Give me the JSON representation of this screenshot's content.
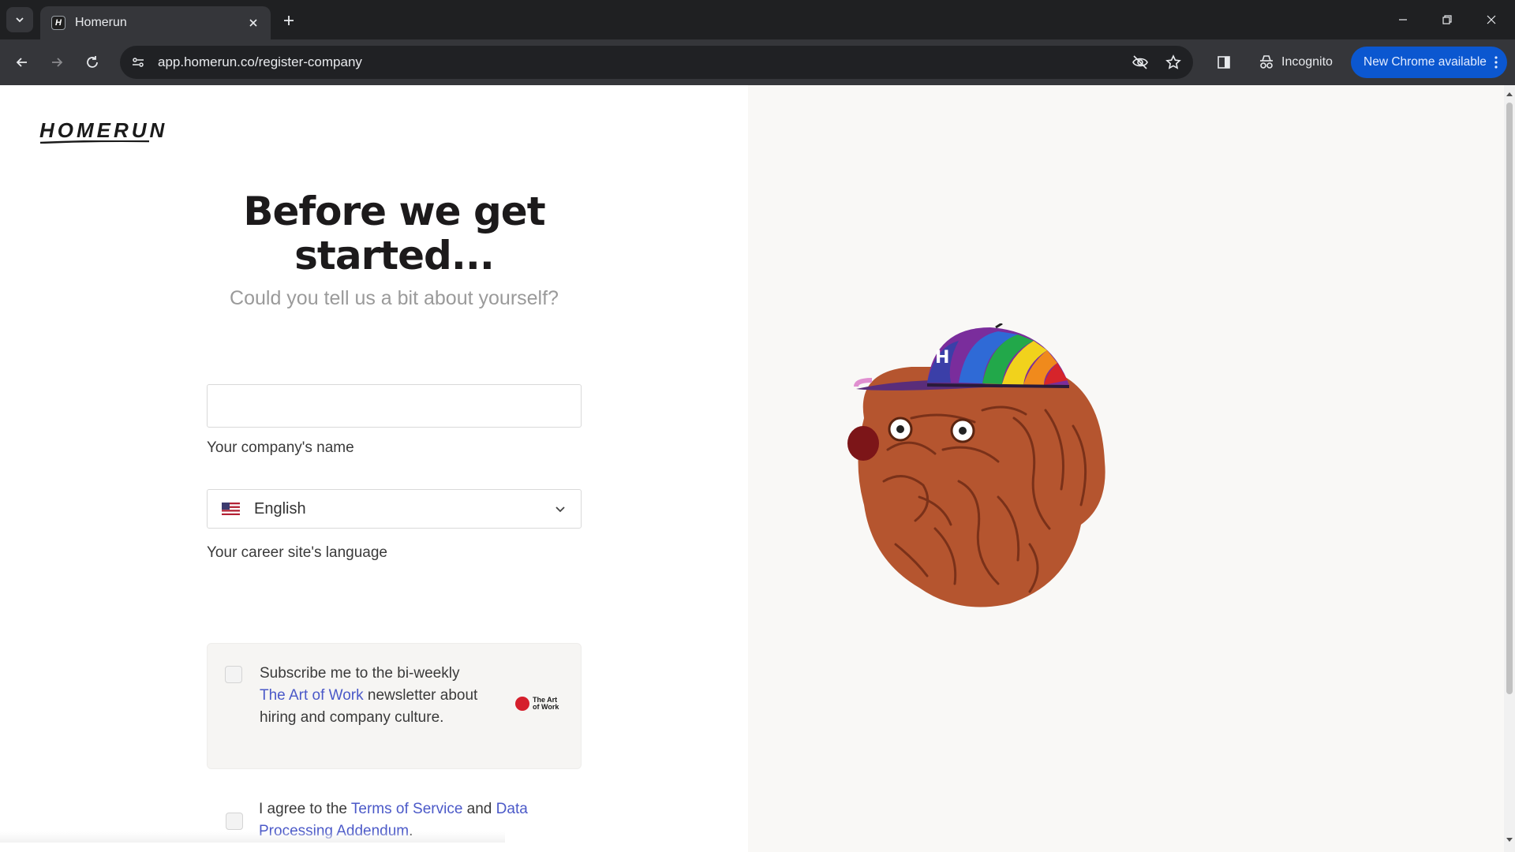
{
  "browser": {
    "tab_title": "Homerun",
    "url": "app.homerun.co/register-company",
    "incognito_label": "Incognito",
    "update_label": "New Chrome available",
    "accent_color": "#0b57d0"
  },
  "page": {
    "logo": "HOMERUN",
    "heading": "Before we get started...",
    "subheading": "Could you tell us a bit about yourself?",
    "company_label": "Your company's name",
    "company_value": "",
    "language_label": "Your career site's language",
    "language_value": "English",
    "newsletter": {
      "text_before": "Subscribe me to the bi-weekly ",
      "link": "The Art of Work",
      "text_after": " newsletter about hiring and company culture.",
      "badge_line1": "The Art",
      "badge_line2": "of Work",
      "checked": false
    },
    "terms": {
      "text_before": "I agree to the ",
      "link1": "Terms of Service",
      "middle": " and ",
      "link2": "Data Processing Addendum",
      "text_after": ".",
      "checked": false
    },
    "link_color": "#4b59c8"
  }
}
